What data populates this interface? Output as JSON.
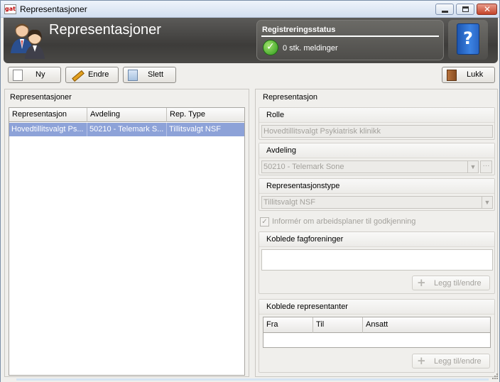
{
  "window": {
    "title": "Representasjoner",
    "app_icon_text": "gat"
  },
  "banner": {
    "title": "Representasjoner",
    "status_title": "Registreringsstatus",
    "status_text": "0 stk. meldinger",
    "help_glyph": "?"
  },
  "toolbar": {
    "new_label": "Ny",
    "edit_label": "Endre",
    "delete_label": "Slett",
    "close_label": "Lukk"
  },
  "left_panel": {
    "title": "Representasjoner",
    "columns": [
      "Representasjon",
      "Avdeling",
      "Rep. Type"
    ],
    "rows": [
      [
        "Hovedtillitsvalgt Ps...",
        "50210 - Telemark S...",
        "Tillitsvalgt NSF"
      ]
    ]
  },
  "right_panel": {
    "title": "Representasjon",
    "rolle": {
      "label": "Rolle",
      "value": "Hovedtillitsvalgt Psykiatrisk klinikk"
    },
    "avdeling": {
      "label": "Avdeling",
      "value": "50210 - Telemark Sone"
    },
    "representasjonstype": {
      "label": "Representasjonstype",
      "value": "Tillitsvalgt NSF"
    },
    "inform_checkbox": {
      "label": "Informér om arbeidsplaner til godkjenning",
      "checked": true
    },
    "koblede_fagforeninger": {
      "label": "Koblede fagforeninger",
      "add_button": "Legg til/endre"
    },
    "koblede_representanter": {
      "label": "Koblede representanter",
      "columns": [
        "Fra",
        "Til",
        "Ansatt"
      ],
      "add_button": "Legg til/endre"
    }
  },
  "colors": {
    "banner": "#4a4946",
    "selection": "#8da2d8",
    "window_bg": "#f0efec"
  }
}
